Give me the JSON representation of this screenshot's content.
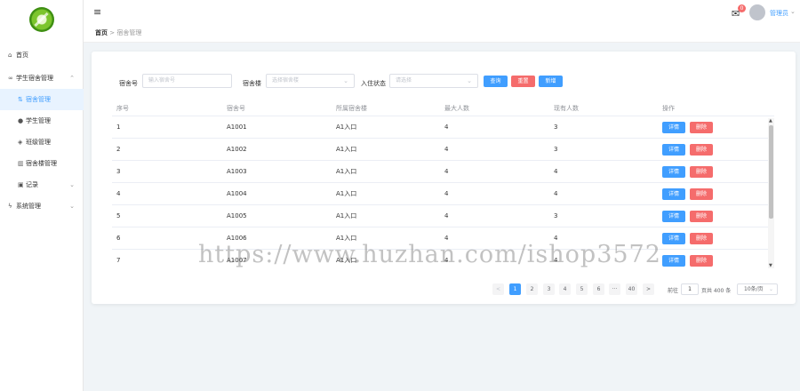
{
  "sidebar": {
    "items": [
      {
        "icon": "home-icon",
        "label": "首页"
      },
      {
        "icon": "link-icon",
        "label": "学生宿舍管理"
      },
      {
        "icon": "swap-icon",
        "label": "宿舍管理"
      },
      {
        "icon": "user-icon",
        "label": "学生管理"
      },
      {
        "icon": "layers-icon",
        "label": "班级管理"
      },
      {
        "icon": "building-icon",
        "label": "宿舍楼管理"
      },
      {
        "icon": "record-icon",
        "label": "记录"
      },
      {
        "icon": "lightning-icon",
        "label": "系统管理"
      }
    ]
  },
  "header": {
    "badge_count": "0",
    "user_name": "管理员",
    "breadcrumb": {
      "home": "首页",
      "separator": ">",
      "current": "宿舍管理"
    }
  },
  "filters": {
    "room_label": "宿舍号",
    "room_placeholder": "输入宿舍号",
    "building_label": "宿舍楼",
    "building_placeholder": "选择宿舍楼",
    "status_label": "入住状态",
    "status_placeholder": "请选择",
    "query_label": "查询",
    "reset_label": "重置",
    "add_label": "新增"
  },
  "table": {
    "columns": [
      "序号",
      "宿舍号",
      "所属宿舍楼",
      "最大人数",
      "现有人数",
      "操作"
    ],
    "rows": [
      [
        "1",
        "A1001",
        "A1入口",
        "4",
        "3"
      ],
      [
        "2",
        "A1002",
        "A1入口",
        "4",
        "3"
      ],
      [
        "3",
        "A1003",
        "A1入口",
        "4",
        "4"
      ],
      [
        "4",
        "A1004",
        "A1入口",
        "4",
        "4"
      ],
      [
        "5",
        "A1005",
        "A1入口",
        "4",
        "3"
      ],
      [
        "6",
        "A1006",
        "A1入口",
        "4",
        "4"
      ],
      [
        "7",
        "A1007",
        "A1入口",
        "4",
        "4"
      ]
    ],
    "detail_label": "详情",
    "delete_label": "删除"
  },
  "pagination": {
    "prev": "<",
    "pages": [
      "1",
      "2",
      "3",
      "4",
      "5",
      "6",
      "···",
      "40"
    ],
    "current": "1",
    "next": ">",
    "goto_label": "前往",
    "goto_value": "1",
    "total_text": "页共 400 条",
    "page_size": "10条/页"
  },
  "watermark": "https://www.huzhan.com/ishop3572",
  "colors": {
    "primary": "#409eff",
    "danger": "#f56c6c",
    "background": "#f0f4f7"
  }
}
